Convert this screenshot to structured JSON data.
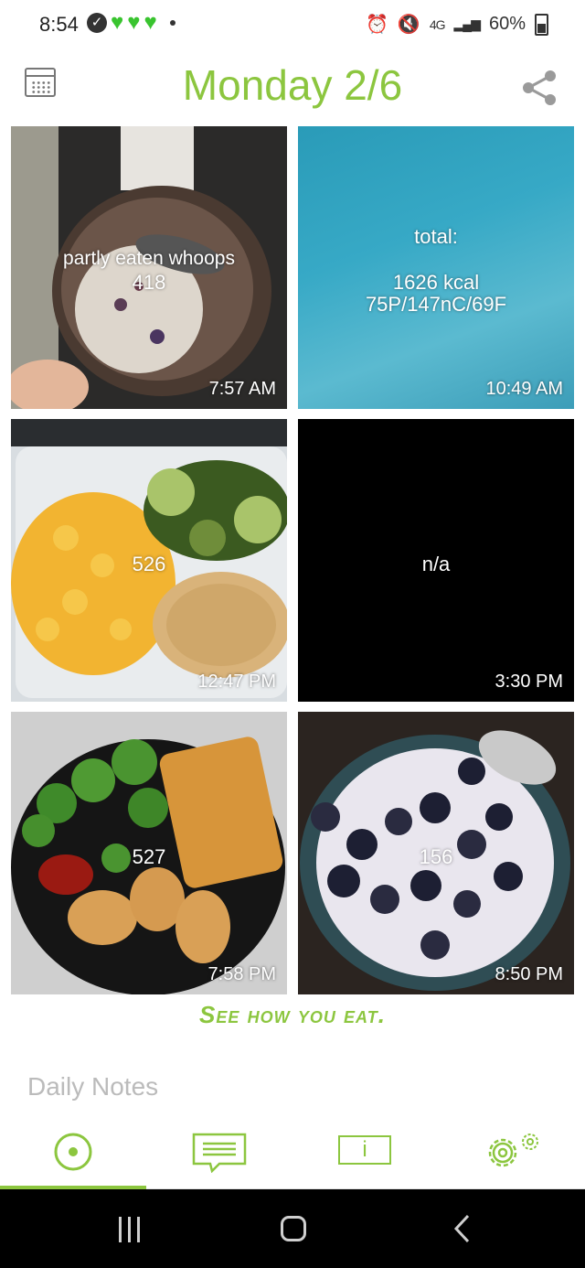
{
  "status_bar": {
    "time": "8:54",
    "battery": "60%",
    "network": "4G",
    "colors": {
      "hearts": "#39c42f"
    }
  },
  "header": {
    "title": "Monday 2/6",
    "left_icon": "calendar-icon",
    "right_icon": "share-icon"
  },
  "tiles": [
    {
      "calories": "418",
      "note": "partly eaten whoops",
      "time": "7:57 AM",
      "type": "photo",
      "photo": "porridge-bowl"
    },
    {
      "label": "total:",
      "kcal": "1626 kcal",
      "macros": "75P/147nC/69F",
      "time": "10:49 AM",
      "type": "summary"
    },
    {
      "calories": "526",
      "time": "12:47 PM",
      "type": "photo",
      "photo": "mac-and-cheese-zucchini-chicken"
    },
    {
      "calories": "n/a",
      "time": "3:30 PM",
      "type": "blank"
    },
    {
      "calories": "527",
      "time": "7:58 PM",
      "type": "photo",
      "photo": "broccoli-tots-fish"
    },
    {
      "calories": "156",
      "time": "8:50 PM",
      "type": "photo",
      "photo": "blueberries-yogurt"
    }
  ],
  "tagline": "See how you eat.",
  "daily_notes": {
    "placeholder": "Daily Notes"
  },
  "app_nav": {
    "items": [
      {
        "icon": "camera-circle-icon",
        "active": true
      },
      {
        "icon": "notes-chat-icon",
        "active": false
      },
      {
        "icon": "info-icon",
        "active": false,
        "glyph": "i"
      },
      {
        "icon": "settings-gears-icon",
        "active": false
      }
    ],
    "accent": "#8cc63f"
  },
  "system_nav": {
    "items": [
      "recent-apps-icon",
      "home-icon",
      "back-icon"
    ]
  }
}
